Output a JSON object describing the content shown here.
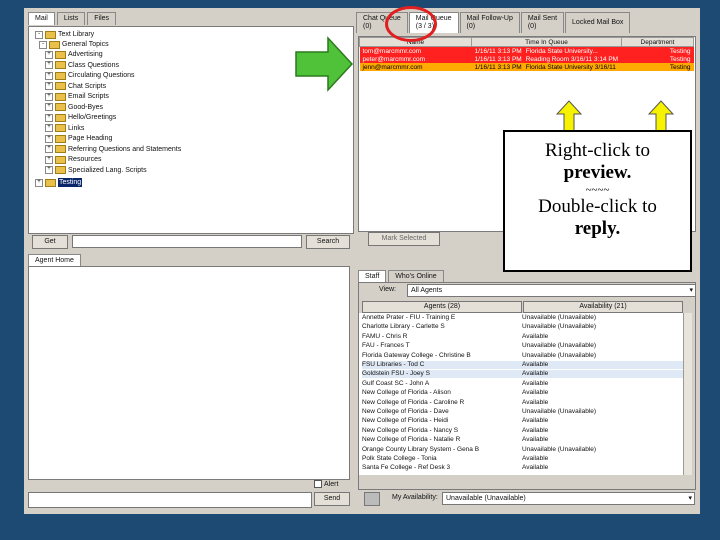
{
  "left_tabs": [
    "Mail",
    "Lists",
    "Files"
  ],
  "tree": {
    "root": "Text Library",
    "group": "General Topics",
    "items": [
      "Advertising",
      "Class Questions",
      "Circulating Questions",
      "Chat Scripts",
      "Email Scripts",
      "Good-Byes",
      "Hello/Greetings",
      "Links",
      "Page Heading",
      "Referring Questions and Statements",
      "Resources",
      "Specialized Lang. Scripts"
    ],
    "selected": "Testing",
    "get_button": "Get",
    "search_button": "Search"
  },
  "queue_tabs": [
    {
      "label": "Chat Queue",
      "count": "(0)"
    },
    {
      "label": "Mail Queue",
      "count": "(3 / 3)"
    },
    {
      "label": "Mail Follow-Up",
      "count": "(0)"
    },
    {
      "label": "Mail Sent",
      "count": "(0)"
    },
    {
      "label": "Locked Mail Box",
      "count": ""
    }
  ],
  "queue_table": {
    "headers": [
      "Name",
      "Time In Queue",
      "Department"
    ],
    "rows": [
      {
        "name": "tom@marcmmr.com",
        "time": "1/16/11 3:13 PM",
        "subject": "Florida State University...",
        "dept": "Testing",
        "color": "#ff2020"
      },
      {
        "name": "peter@marcmmr.com",
        "time": "1/16/11 3:13 PM",
        "subject": "Reading Room 3/16/11 3:14 PM",
        "dept": "Testing",
        "color": "#ff2020"
      },
      {
        "name": "jenn@marcmmr.com",
        "time": "1/16/11 3:13 PM",
        "subject": "Florida State University 3/16/11",
        "dept": "Testing",
        "color": "#ffaa00"
      }
    ],
    "bottom_button": "Mark Selected"
  },
  "agent_tab": "Agent Home",
  "alert_label": "Alert",
  "send_button": "Send",
  "right_tabs": [
    "Staff",
    "Who's Online"
  ],
  "view_label": "View:",
  "view_value": "All Agents",
  "agent_headers": [
    "Agents (28)",
    "Availability (21)"
  ],
  "agents": [
    {
      "name": "Annette Prater - FIU - Training E",
      "status": "Unavailable (Unavailable)"
    },
    {
      "name": "Charlotte Library - Carlette S",
      "status": "Unavailable (Unavailable)"
    },
    {
      "name": "FAMU - Chris R",
      "status": "Available"
    },
    {
      "name": "FAU - Frances T",
      "status": "Unavailable (Unavailable)"
    },
    {
      "name": "Florida Gateway College - Christine B",
      "status": "Unavailable (Unavailable)"
    },
    {
      "name": "FSU Libraries - Tod C",
      "status": "Available"
    },
    {
      "name": "Goldstein FSU - Joey S",
      "status": "Available"
    },
    {
      "name": "Gulf Coast SC - John A",
      "status": "Available"
    },
    {
      "name": "New College of Florida - Alison",
      "status": "Available"
    },
    {
      "name": "New College of Florida - Caroline R",
      "status": "Available"
    },
    {
      "name": "New College of Florida - Dave",
      "status": "Unavailable (Unavailable)"
    },
    {
      "name": "New College of Florida - Heidi",
      "status": "Available"
    },
    {
      "name": "New College of Florida - Nancy S",
      "status": "Available"
    },
    {
      "name": "New College of Florida - Natalie R",
      "status": "Available"
    },
    {
      "name": "Orange County Library System - Gena B",
      "status": "Unavailable (Unavailable)"
    },
    {
      "name": "Polk State College - Tonia",
      "status": "Available"
    },
    {
      "name": "Santa Fe College - Ref Desk 3",
      "status": "Available"
    }
  ],
  "my_availability_label": "My Availability:",
  "my_availability_value": "Unavailable (Unavailable)",
  "callout": {
    "line1": "Right-click to",
    "line2": "preview.",
    "line3": "~~~~",
    "line4": "Double-click to",
    "line5": "reply."
  },
  "colors": {
    "row_red": "#ff2020",
    "row_orange": "#ffaa00",
    "arrow_green": "#4fc23a",
    "arrow_yellow": "#f6f200",
    "circle_red": "#e02020",
    "background": "#1d4a73"
  }
}
